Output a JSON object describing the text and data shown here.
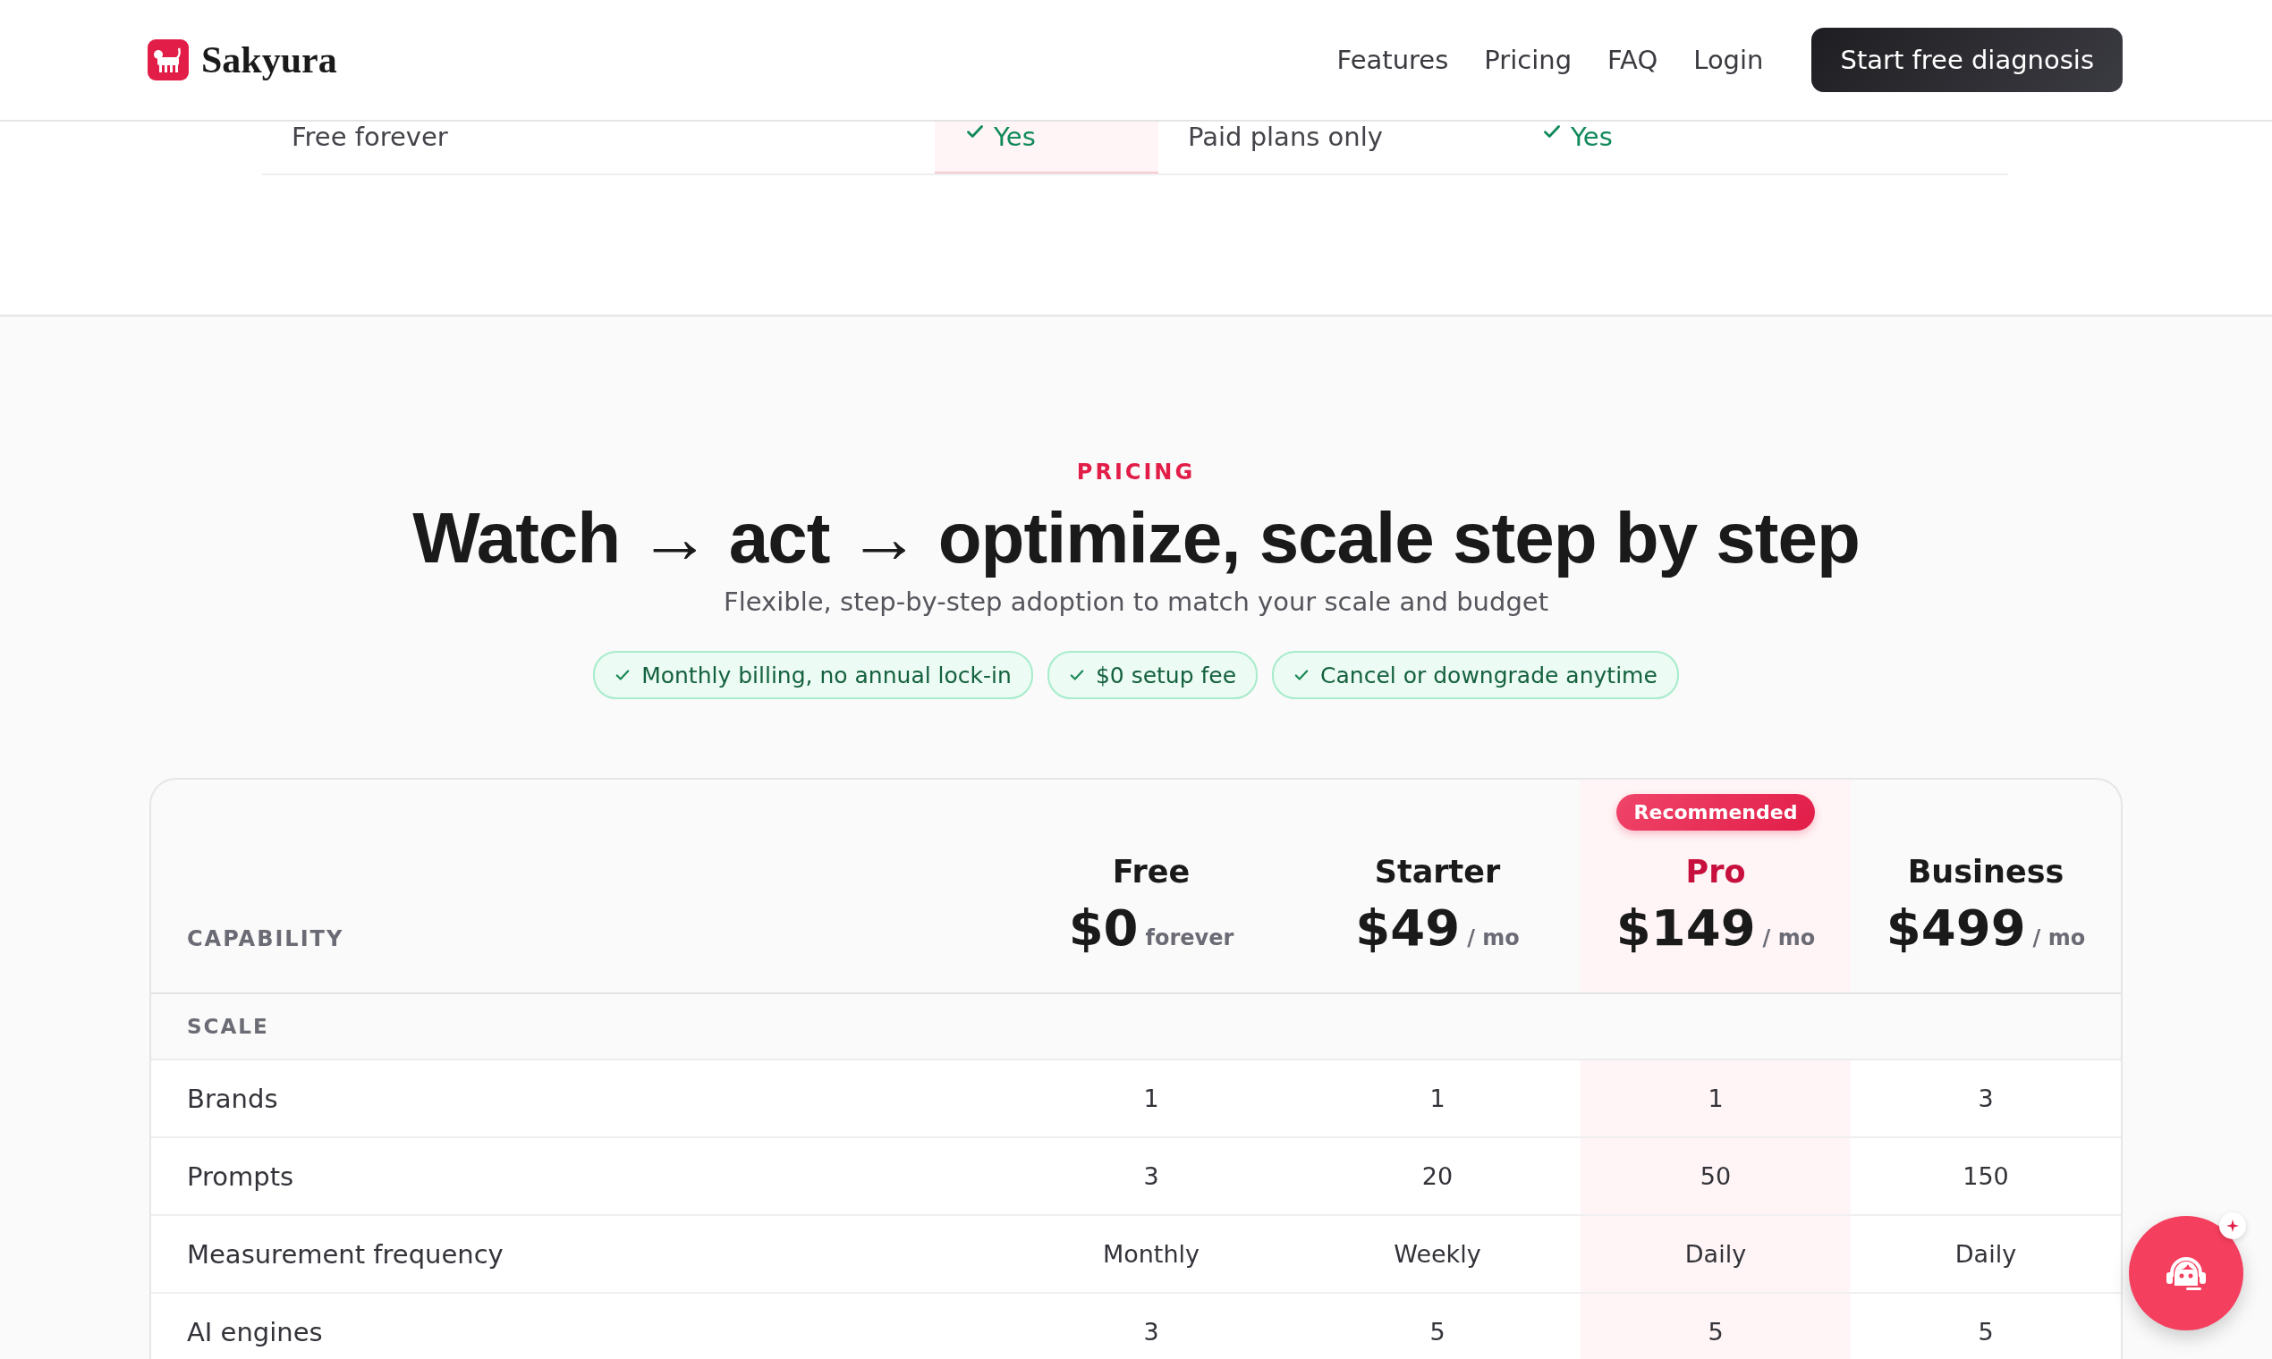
{
  "header": {
    "brand": "Sakyura",
    "nav": [
      {
        "label": "Features"
      },
      {
        "label": "Pricing"
      },
      {
        "label": "FAQ"
      },
      {
        "label": "Login"
      }
    ],
    "cta": "Start free diagnosis"
  },
  "comparison_row": {
    "cells": [
      {
        "kind": "text",
        "text": "Free forever",
        "highlighted": false
      },
      {
        "kind": "check",
        "text": "Yes",
        "highlighted": true
      },
      {
        "kind": "text",
        "text": "Paid plans only",
        "highlighted": false
      },
      {
        "kind": "check",
        "text": "Yes",
        "highlighted": false
      }
    ]
  },
  "pricing": {
    "eyebrow": "PRICING",
    "title": "Watch → act → optimize, scale step by step",
    "subtitle": "Flexible, step-by-step adoption to match your scale and budget",
    "chips": [
      "Monthly billing, no annual lock-in",
      "$0 setup fee",
      "Cancel or downgrade anytime"
    ]
  },
  "table": {
    "capability_header": "CAPABILITY",
    "plans": [
      {
        "name": "Free",
        "price": "$0",
        "period": "forever",
        "recommended": false
      },
      {
        "name": "Starter",
        "price": "$49",
        "period": "/ mo",
        "recommended": false
      },
      {
        "name": "Pro",
        "price": "$149",
        "period": "/ mo",
        "recommended": true,
        "badge": "Recommended"
      },
      {
        "name": "Business",
        "price": "$499",
        "period": "/ mo",
        "recommended": false
      }
    ],
    "groups": [
      {
        "label": "SCALE",
        "rows": [
          {
            "label": "Brands",
            "values": [
              "1",
              "1",
              "1",
              "3"
            ]
          },
          {
            "label": "Prompts",
            "values": [
              "3",
              "20",
              "50",
              "150"
            ]
          },
          {
            "label": "Measurement frequency",
            "values": [
              "Monthly",
              "Weekly",
              "Daily",
              "Daily"
            ]
          },
          {
            "label": "AI engines",
            "values": [
              "3",
              "5",
              "5",
              "5"
            ]
          }
        ]
      }
    ]
  }
}
